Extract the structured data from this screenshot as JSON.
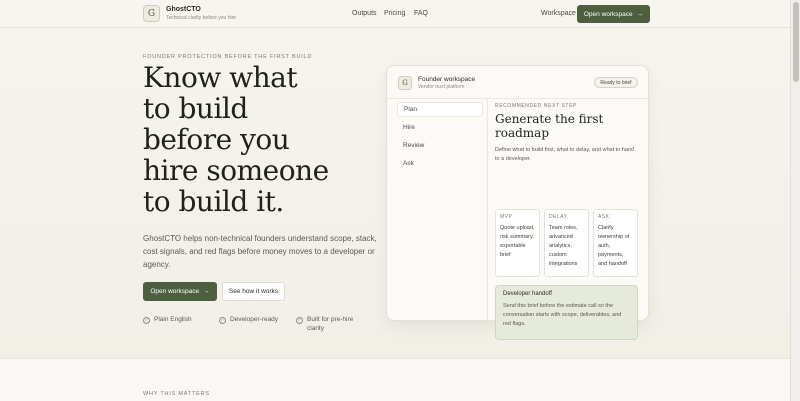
{
  "brand": {
    "logo_letter": "G",
    "name": "GhostCTO",
    "tagline": "Technical clarity before you hire"
  },
  "nav": {
    "links": [
      "Outputs",
      "Pricing",
      "FAQ"
    ],
    "workspace": "Workspace",
    "cta": "Open workspace",
    "cta_arrow": "→"
  },
  "hero": {
    "eyebrow": "FOUNDER PROTECTION BEFORE THE FIRST BUILD",
    "title_lines": [
      "Know what",
      "to build",
      "before you",
      "hire someone",
      "to build it."
    ],
    "description": "GhostCTO helps non-technical founders understand scope, stack, cost signals, and red flags before money moves to a developer or agency.",
    "primary_cta": "Open workspace",
    "primary_arrow": "→",
    "secondary_cta": "See how it works",
    "features": [
      "Plain English",
      "Developer-ready",
      "Built for pre-hire clarity"
    ],
    "check_glyph": "✓"
  },
  "card": {
    "logo_letter": "G",
    "title": "Founder workspace",
    "subtitle": "Vendor trust platform",
    "badge": "Ready to brief",
    "sidebar": [
      "Plan",
      "Hire",
      "Review",
      "Ask"
    ],
    "eyebrow": "RECOMMENDED NEXT STEP",
    "heading": "Generate the first roadmap",
    "description": "Define what to build first, what to delay, and what to hand to a developer.",
    "columns": [
      {
        "head": "MVP",
        "body": "Quote upload, risk summary, exportable brief"
      },
      {
        "head": "DELAY",
        "body": "Team roles, advanced analytics, custom integrations"
      },
      {
        "head": "ASK",
        "body": "Clarify ownership of auth, payments, and handoff"
      }
    ],
    "handoff": {
      "title": "Developer handoff",
      "body": "Send this brief before the estimate call so the conversation starts with scope, deliverables, and red flags."
    }
  },
  "section": {
    "eyebrow": "WHY THIS MATTERS"
  },
  "colors": {
    "accent": "#4d5f3e",
    "background": "#f4f1ea",
    "handoff_bg": "#e6eadb"
  }
}
